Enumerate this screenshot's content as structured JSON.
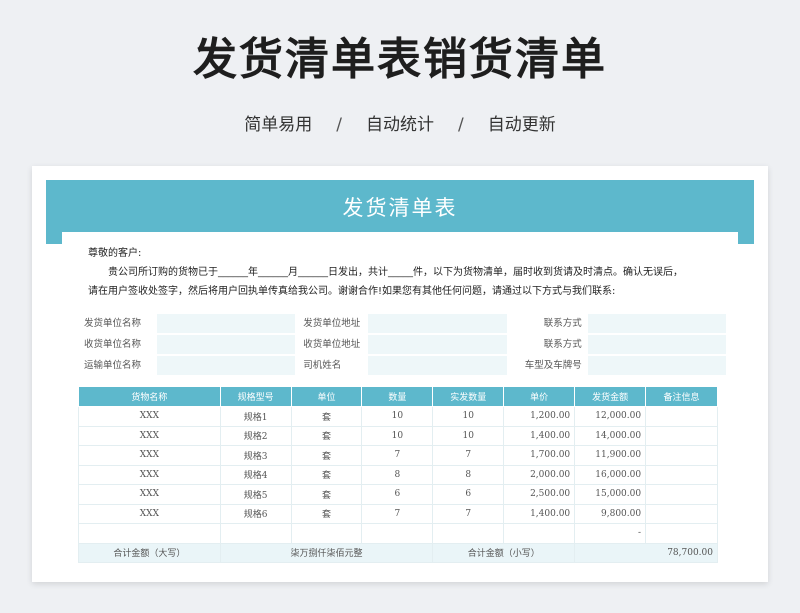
{
  "page": {
    "title": "发货清单表销货清单",
    "tagline": [
      "简单易用",
      "自动统计",
      "自动更新"
    ],
    "tagline_sep": "/"
  },
  "sheet": {
    "title": "发货清单表",
    "greeting": "尊敬的客户:",
    "line1": "贵公司所订购的货物已于______年______月______日发出，共计_____件，以下为货物清单，届时收到货请及时清点。确认无误后，",
    "line2": "请在用户签收处签字，然后将用户回执单传真给我公司。谢谢合作!如果您有其他任何问题，请通过以下方式与我们联系:",
    "info": [
      [
        "发货单位名称",
        "发货单位地址",
        "联系方式"
      ],
      [
        "收货单位名称",
        "收货单位地址",
        "联系方式"
      ],
      [
        "运输单位名称",
        "司机姓名",
        "车型及车牌号"
      ]
    ],
    "headers": [
      "货物名称",
      "规格型号",
      "单位",
      "数量",
      "实发数量",
      "单价",
      "发货金额",
      "备注信息"
    ],
    "rows": [
      [
        "XXX",
        "规格1",
        "套",
        "10",
        "10",
        "1,200.00",
        "12,000.00",
        ""
      ],
      [
        "XXX",
        "规格2",
        "套",
        "10",
        "10",
        "1,400.00",
        "14,000.00",
        ""
      ],
      [
        "XXX",
        "规格3",
        "套",
        "7",
        "7",
        "1,700.00",
        "11,900.00",
        ""
      ],
      [
        "XXX",
        "规格4",
        "套",
        "8",
        "8",
        "2,000.00",
        "16,000.00",
        ""
      ],
      [
        "XXX",
        "规格5",
        "套",
        "6",
        "6",
        "2,500.00",
        "15,000.00",
        ""
      ],
      [
        "XXX",
        "规格6",
        "套",
        "7",
        "7",
        "1,400.00",
        "9,800.00",
        ""
      ],
      [
        "",
        "",
        "",
        "",
        "",
        "",
        "-",
        ""
      ]
    ],
    "sum": {
      "label_upper": "合计金额（大写）",
      "value_upper": "柒万捌仟柒佰元整",
      "label_lower": "合计金额（小写）",
      "value_lower": "78,700.00"
    }
  },
  "colors": {
    "accent": "#5db8cc",
    "field_bg": "#eef7f9",
    "sum_bg": "#eaf5f8"
  }
}
